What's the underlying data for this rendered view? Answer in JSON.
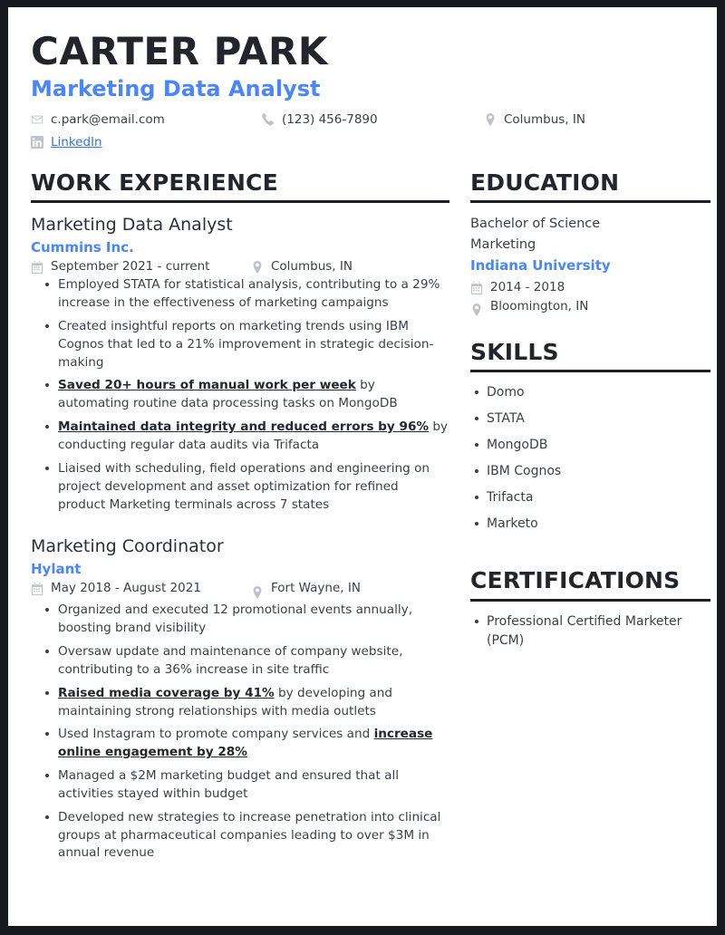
{
  "theme": {
    "accent": "#4a86f7",
    "link": "#2d76f0",
    "text": "#3b3f45",
    "heading": "#22262c",
    "icon": "#bfc3c9",
    "page_bg": "#ffffff",
    "frame": "#16181d"
  },
  "header": {
    "name": "CARTER PARK",
    "title": "Marketing Data Analyst",
    "contacts": {
      "email": "c.park@email.com",
      "phone": "(123) 456-7890",
      "location": "Columbus, IN",
      "linkedin_label": "LinkedIn"
    },
    "icons": {
      "email": "envelope-icon",
      "phone": "phone-icon",
      "location": "location-pin-icon",
      "linkedin": "linkedin-icon"
    }
  },
  "sections": {
    "work": {
      "heading": "WORK EXPERIENCE",
      "jobs": [
        {
          "title": "Marketing Data Analyst",
          "company": "Cummins Inc.",
          "dates": "September 2021 - current",
          "location": "Columbus, IN",
          "bullets": [
            {
              "parts": [
                {
                  "text": "Employed STATA for statistical analysis, contributing to a 29% increase in the effectiveness of marketing campaigns",
                  "hl": false
                }
              ]
            },
            {
              "parts": [
                {
                  "text": "Created insightful reports on marketing trends using IBM Cognos that led to a 21% improvement in strategic decision-making",
                  "hl": false
                }
              ]
            },
            {
              "parts": [
                {
                  "text": "Saved 20+ hours of manual work per week",
                  "hl": true
                },
                {
                  "text": " by automating routine data processing tasks on MongoDB",
                  "hl": false
                }
              ]
            },
            {
              "parts": [
                {
                  "text": "Maintained data integrity and reduced errors by 96%",
                  "hl": true
                },
                {
                  "text": " by conducting regular data audits via Trifacta",
                  "hl": false
                }
              ]
            },
            {
              "parts": [
                {
                  "text": "Liaised with scheduling, field operations and engineering on project development and asset optimization for refined product Marketing terminals across 7 states",
                  "hl": false
                }
              ]
            }
          ]
        },
        {
          "title": "Marketing Coordinator",
          "company": "Hylant",
          "dates": "May 2018 - August 2021",
          "location": "Fort Wayne, IN",
          "bullets": [
            {
              "parts": [
                {
                  "text": "Organized and executed 12 promotional events annually, boosting brand visibility",
                  "hl": false
                }
              ]
            },
            {
              "parts": [
                {
                  "text": "Oversaw update and maintenance of company website, contributing to a 36% increase in site traffic",
                  "hl": false
                }
              ]
            },
            {
              "parts": [
                {
                  "text": "Raised media coverage by 41%",
                  "hl": true
                },
                {
                  "text": " by developing and maintaining strong relationships with media outlets",
                  "hl": false
                }
              ]
            },
            {
              "parts": [
                {
                  "text": "Used Instagram to promote company services and ",
                  "hl": false
                },
                {
                  "text": "increase online engagement by 28%",
                  "hl": true
                }
              ]
            },
            {
              "parts": [
                {
                  "text": "Managed a $2M marketing budget and ensured that all activities stayed within budget",
                  "hl": false
                }
              ]
            },
            {
              "parts": [
                {
                  "text": "Developed new strategies to increase penetration into clinical groups at pharmaceutical companies leading to over $3M in annual revenue",
                  "hl": false
                }
              ]
            }
          ]
        }
      ]
    },
    "education": {
      "heading": "EDUCATION",
      "degree": "Bachelor of Science",
      "field": "Marketing",
      "school": "Indiana University",
      "dates": "2014 - 2018",
      "location": "Bloomington, IN"
    },
    "skills": {
      "heading": "SKILLS",
      "items": [
        "Domo",
        "STATA",
        "MongoDB",
        "IBM Cognos",
        "Trifacta",
        "Marketo"
      ]
    },
    "certifications": {
      "heading": "CERTIFICATIONS",
      "items": [
        "Professional Certified Marketer (PCM)"
      ]
    }
  }
}
